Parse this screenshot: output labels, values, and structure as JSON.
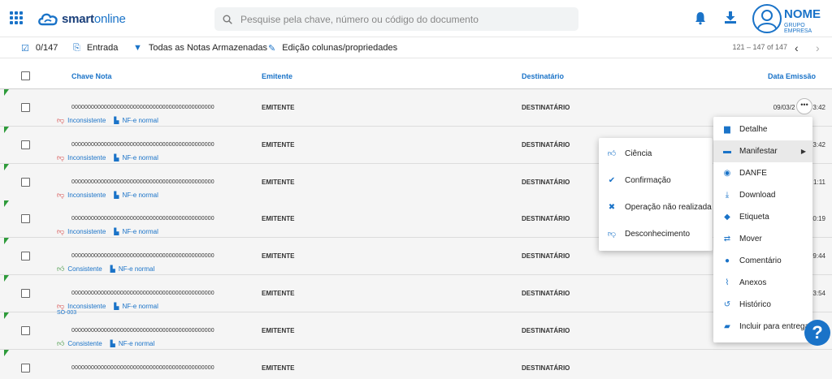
{
  "header": {
    "logo_text_bold": "smart",
    "logo_text_light": "online",
    "search_placeholder": "Pesquise pela chave, número ou código do documento",
    "user_name": "NOME",
    "user_company": "GRUPO EMPRESA"
  },
  "toolbar": {
    "selected_count": "0/147",
    "entrada_label": "Entrada",
    "filter_label": "Todas as Notas Armazenadas",
    "edit_columns_label": "Edição colunas/propriedades",
    "pager_text": "121 – 147 of 147"
  },
  "table": {
    "columns": {
      "chave": "Chave Nota",
      "emitente": "Emitente",
      "destinatario": "Destinatário",
      "data": "Data Emissão"
    },
    "rows": [
      {
        "key": "00000000000000000000000000000000000000000000",
        "emitente": "EMITENTE",
        "destinatario": "DESTINATÁRIO",
        "date": "09/03/2",
        "time_suffix": "3:42",
        "status": "Inconsistente",
        "type": "NF-e normal"
      },
      {
        "key": "00000000000000000000000000000000000000000000",
        "emitente": "EMITENTE",
        "destinatario": "DESTINATÁRIO",
        "date": "",
        "time_suffix": "3:42",
        "status": "Inconsistente",
        "type": "NF-e normal"
      },
      {
        "key": "00000000000000000000000000000000000000000000",
        "emitente": "EMITENTE",
        "destinatario": "DESTINATÁRIO",
        "date": "",
        "time_suffix": "1:11",
        "status": "Inconsistente",
        "type": "NF-e normal"
      },
      {
        "key": "00000000000000000000000000000000000000000000",
        "emitente": "EMITENTE",
        "destinatario": "DESTINATÁRIO",
        "date": "",
        "time_suffix": "0:19",
        "status": "Inconsistente",
        "type": "NF-e normal"
      },
      {
        "key": "00000000000000000000000000000000000000000000",
        "emitente": "EMITENTE",
        "destinatario": "DESTINATÁRIO",
        "date": "",
        "time_suffix": "9:44",
        "status": "Consistente",
        "type": "NF-e normal"
      },
      {
        "key": "00000000000000000000000000000000000000000000",
        "emitente": "EMITENTE",
        "destinatario": "DESTINATÁRIO",
        "date": "",
        "time_suffix": "3:54",
        "status": "Inconsistente",
        "type": "NF-e normal"
      },
      {
        "key": "00000000000000000000000000000000000000000000",
        "emitente": "EMITENTE",
        "destinatario": "DESTINATÁRIO",
        "date": "",
        "time_suffix": "",
        "status": "Consistente",
        "type": "NF-e normal"
      },
      {
        "key": "00000000000000000000000000000000000000000000",
        "emitente": "EMITENTE",
        "destinatario": "DESTINATÁRIO",
        "date": "",
        "time_suffix": "",
        "status": "",
        "type": ""
      }
    ],
    "so_label": "SO-003"
  },
  "context_menu": {
    "items": [
      {
        "label": "Detalhe",
        "icon": "document-icon"
      },
      {
        "label": "Manifestar",
        "icon": "briefcase-icon"
      },
      {
        "label": "DANFE",
        "icon": "eye-icon"
      },
      {
        "label": "Download",
        "icon": "download-icon"
      },
      {
        "label": "Etiqueta",
        "icon": "tag-icon"
      },
      {
        "label": "Mover",
        "icon": "swap-icon"
      },
      {
        "label": "Comentário",
        "icon": "comment-icon"
      },
      {
        "label": "Anexos",
        "icon": "paperclip-icon"
      },
      {
        "label": "Histórico",
        "icon": "history-icon"
      },
      {
        "label": "Incluir para entrega",
        "icon": "truck-icon"
      }
    ]
  },
  "submenu": {
    "items": [
      {
        "label": "Ciência",
        "icon": "thumbs-up-icon"
      },
      {
        "label": "Confirmação",
        "icon": "check-circle-icon"
      },
      {
        "label": "Operação não realizada",
        "icon": "x-circle-icon"
      },
      {
        "label": "Desconhecimento",
        "icon": "thumbs-down-icon"
      }
    ]
  },
  "colors": {
    "accent": "#1a73c8",
    "row_bg": "#f5f5f5",
    "corner_green": "#2e9b3a",
    "consistent_green": "#2e8b2e",
    "inconsistent_red": "#d23b3b"
  }
}
